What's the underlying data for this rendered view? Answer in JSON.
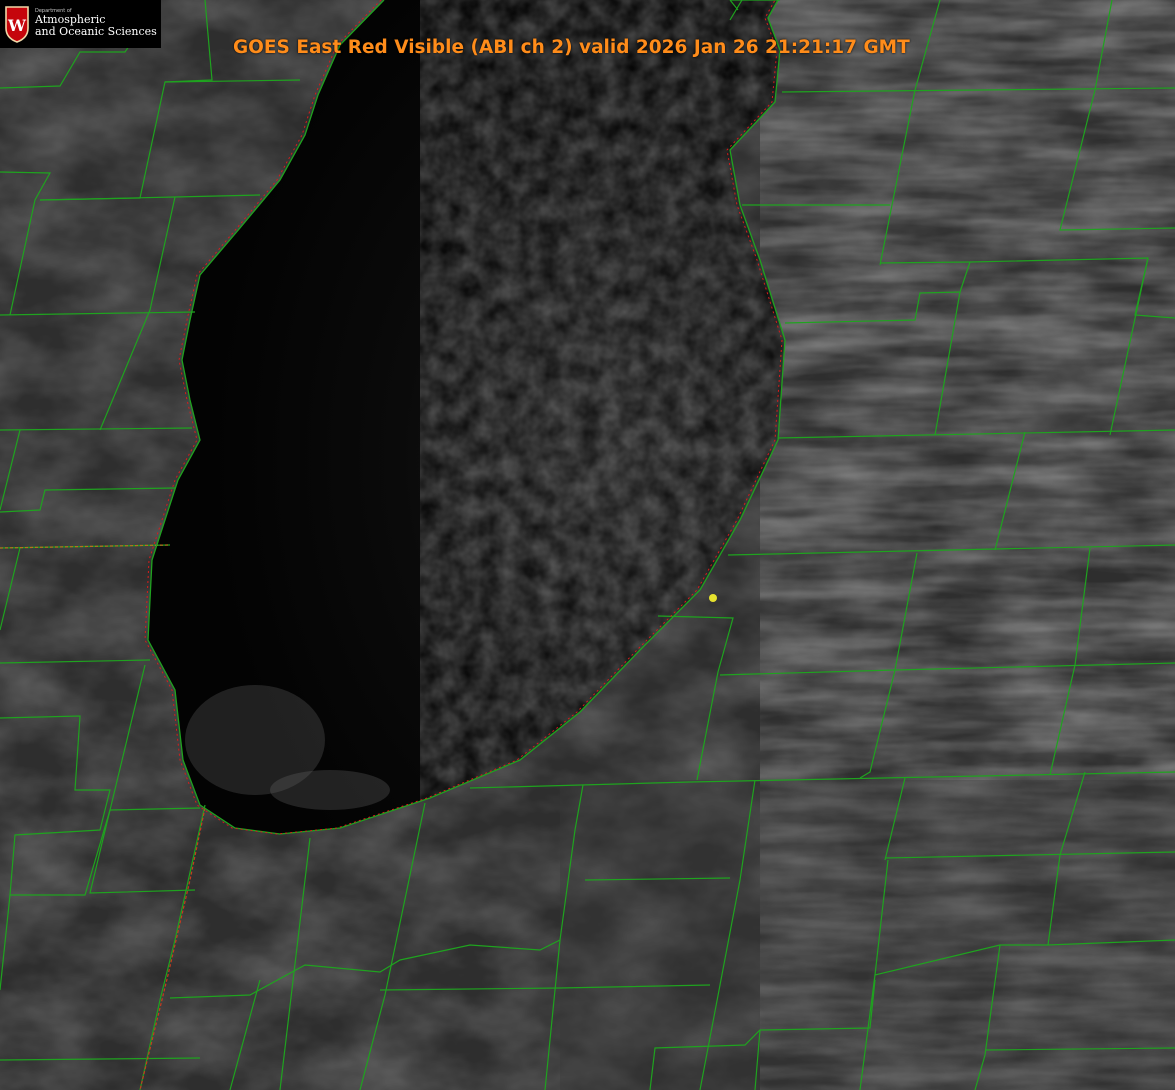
{
  "header": {
    "title": "GOES East Red Visible (ABI ch 2) valid 2026 Jan 26 21:21:17 GMT"
  },
  "logo": {
    "dept_label": "Department of",
    "line1": "Atmospheric",
    "line2": "and Oceanic Sciences",
    "crest_letter": "W"
  },
  "map": {
    "layers": [
      "satellite-imagery",
      "lake-surface",
      "county-boundaries",
      "state-boundaries",
      "shoreline"
    ],
    "marker": "station-marker"
  },
  "colors": {
    "title": "#ff8c1a",
    "county_lines": "#1fa31f",
    "state_lines": "#c83a1e",
    "shoreline": "#d81c1c",
    "marker": "#e6e22e",
    "lake": "#040404",
    "land": "#2e2e2e",
    "crest": "#c5050c"
  }
}
